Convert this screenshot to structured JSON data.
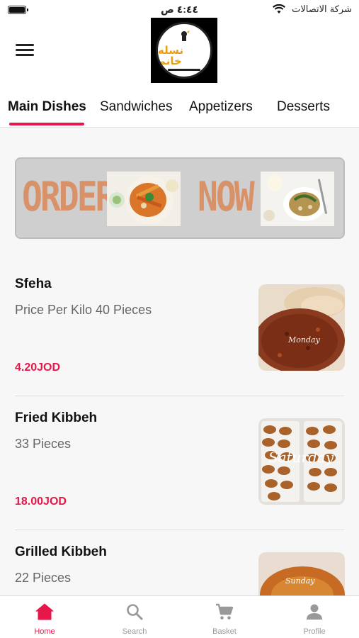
{
  "status_bar": {
    "time": "٤:٤٤ ص",
    "carrier": "شركة الاتصالات"
  },
  "header": {
    "logo_text": "نسله خانم"
  },
  "tabs": [
    {
      "label": "Main Dishes"
    },
    {
      "label": "Sandwiches"
    },
    {
      "label": "Appetizers"
    },
    {
      "label": "Desserts"
    }
  ],
  "banner": {
    "word1": "ORDER",
    "word2": "NOW"
  },
  "items": [
    {
      "name": "Sfeha",
      "description": "Price Per Kilo 40 Pieces",
      "price": "4.20JOD",
      "image_caption": "Monday"
    },
    {
      "name": "Fried Kibbeh",
      "description": "33 Pieces",
      "price": "18.00JOD",
      "image_caption": "Saturday"
    },
    {
      "name": "Grilled Kibbeh",
      "description": "22 Pieces",
      "price": "",
      "image_caption": "Sunday"
    }
  ],
  "bottom_nav": [
    {
      "label": "Home",
      "icon": "home-icon"
    },
    {
      "label": "Search",
      "icon": "search-icon"
    },
    {
      "label": "Basket",
      "icon": "cart-icon"
    },
    {
      "label": "Profile",
      "icon": "profile-icon"
    }
  ],
  "colors": {
    "accent": "#e8174a",
    "banner_text": "#d8926a",
    "banner_bg": "#cfcfcf",
    "inactive_nav": "#999999"
  }
}
